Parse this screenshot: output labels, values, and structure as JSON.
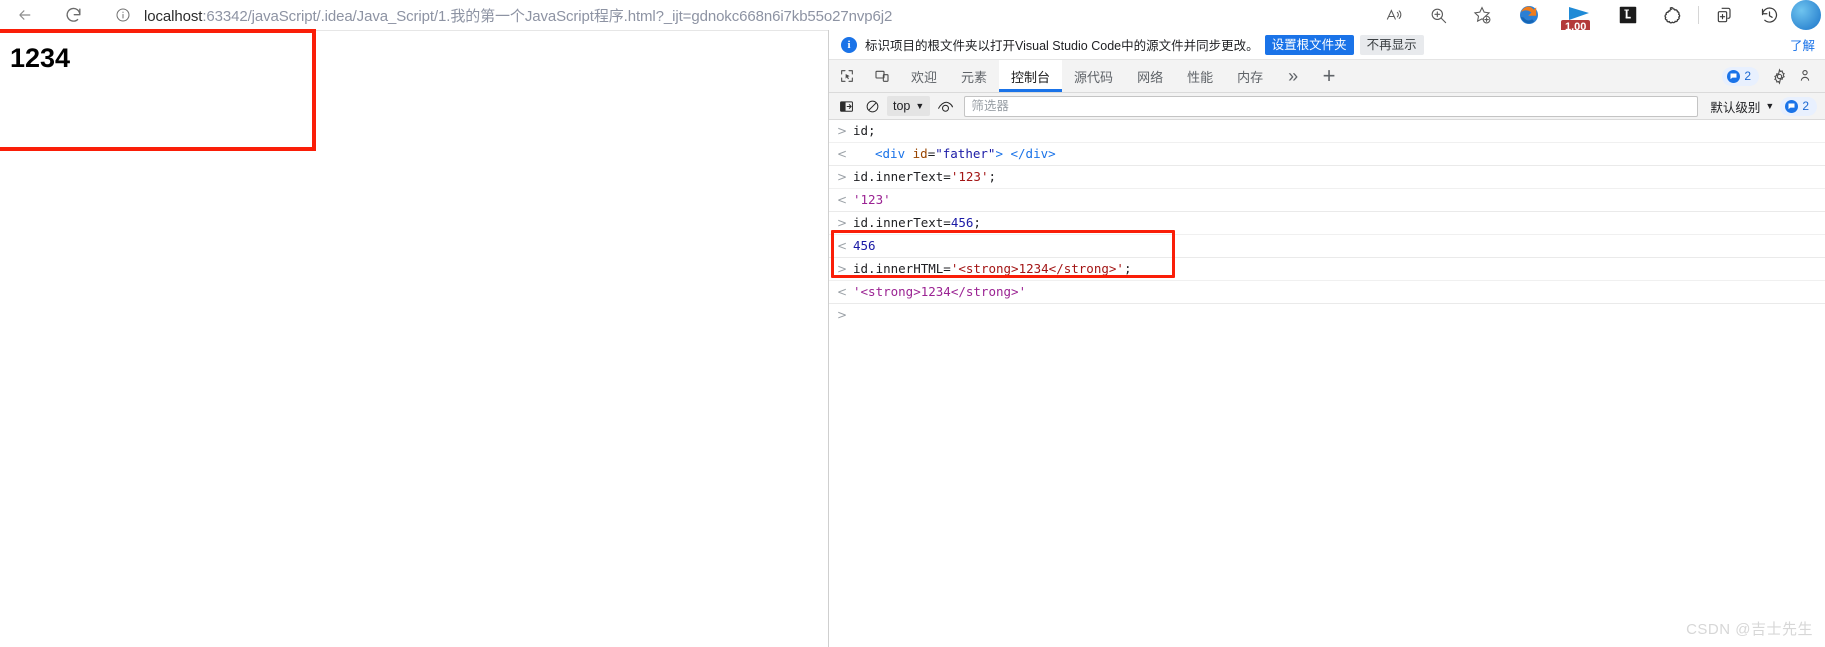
{
  "browser": {
    "back_label": "back-arrow",
    "reload_label": "reload",
    "url_host": "localhost",
    "url_rest": ":63342/javaScript/.idea/Java_Script/1.我的第一个JavaScript程序.html?_ijt=gdnokc668n6i7kb55o27nvp6j2",
    "url_full": "localhost:63342/javaScript/.idea/Java_Script/1.我的第一个JavaScript程序.html?_ijt=gdnokc668n6i7kb55o27nvp6j2",
    "info_icon": "site-info-icon",
    "toolbar_icons": [
      {
        "name": "read-aloud-icon",
        "glyph": "A"
      },
      {
        "name": "zoom-icon",
        "glyph": "⊕"
      },
      {
        "name": "add-favorite-icon",
        "glyph": "☆"
      },
      {
        "name": "extension-ie-mode-icon",
        "glyph": "●"
      },
      {
        "name": "extension-ruler-icon",
        "glyph": "▸"
      },
      {
        "name": "extension-l-icon",
        "glyph": "L"
      },
      {
        "name": "extension-puzzle-icon",
        "glyph": "✲"
      },
      {
        "name": "split-screen-icon",
        "glyph": "⧉"
      },
      {
        "name": "history-icon",
        "glyph": "↺"
      }
    ],
    "zoom_badge": "1.00",
    "profile_avatar": "avatar"
  },
  "page": {
    "content_text": "1234",
    "highlight_color": "#fa1e08"
  },
  "devtools": {
    "notification": {
      "text": "标识项目的根文件夹以打开Visual Studio Code中的源文件并同步更改。",
      "primary_button": "设置根文件夹",
      "secondary_button": "不再显示",
      "learn_more": "了解"
    },
    "tabs": [
      {
        "label": "欢迎",
        "active": false
      },
      {
        "label": "元素",
        "active": false
      },
      {
        "label": "控制台",
        "active": true
      },
      {
        "label": "源代码",
        "active": false
      },
      {
        "label": "网络",
        "active": false
      },
      {
        "label": "性能",
        "active": false
      },
      {
        "label": "内存",
        "active": false
      }
    ],
    "tabs_more": "»",
    "tabs_add": "+",
    "issues_count": "2",
    "settings_icon": "gear-icon",
    "console_toolbar": {
      "sidebar_toggle": "console-sidebar-toggle-icon",
      "clear_icon": "clear-console-icon",
      "context_value": "top",
      "eye_icon": "live-expression-icon",
      "filter_placeholder": "筛选器",
      "filter_value": "",
      "level_label": "默认级别",
      "issues_count": "2"
    },
    "console_entries": [
      {
        "kind": "input",
        "marker": ">",
        "tokens": [
          {
            "cls": "tok-plain",
            "t": "id;"
          }
        ]
      },
      {
        "kind": "result",
        "marker": "<",
        "indent": true,
        "tokens": [
          {
            "cls": "tok-tag",
            "t": "<div "
          },
          {
            "cls": "tok-attr",
            "t": "id"
          },
          {
            "cls": "tok-plain",
            "t": "="
          },
          {
            "cls": "tok-attrval",
            "t": "\"father\""
          },
          {
            "cls": "tok-tag",
            "t": "> </div>"
          }
        ]
      },
      {
        "kind": "input",
        "marker": ">",
        "tokens": [
          {
            "cls": "tok-plain",
            "t": "id.innerText="
          },
          {
            "cls": "tok-string",
            "t": "'123'"
          },
          {
            "cls": "tok-plain",
            "t": ";"
          }
        ]
      },
      {
        "kind": "result",
        "marker": "<",
        "tokens": [
          {
            "cls": "tok-res-str",
            "t": "'123'"
          }
        ]
      },
      {
        "kind": "input",
        "marker": ">",
        "tokens": [
          {
            "cls": "tok-plain",
            "t": "id.innerText="
          },
          {
            "cls": "tok-num",
            "t": "456"
          },
          {
            "cls": "tok-plain",
            "t": ";"
          }
        ]
      },
      {
        "kind": "result",
        "marker": "<",
        "tokens": [
          {
            "cls": "tok-num",
            "t": "456"
          }
        ]
      },
      {
        "kind": "input",
        "marker": ">",
        "tokens": [
          {
            "cls": "tok-plain",
            "t": "id.innerHTML="
          },
          {
            "cls": "tok-string",
            "t": "'<strong>1234</strong>'"
          },
          {
            "cls": "tok-plain",
            "t": ";"
          }
        ]
      },
      {
        "kind": "result",
        "marker": "<",
        "tokens": [
          {
            "cls": "tok-res-str",
            "t": "'<strong>1234</strong>'"
          }
        ]
      }
    ],
    "prompt_marker": ">"
  },
  "watermark": "CSDN @吉士先生"
}
